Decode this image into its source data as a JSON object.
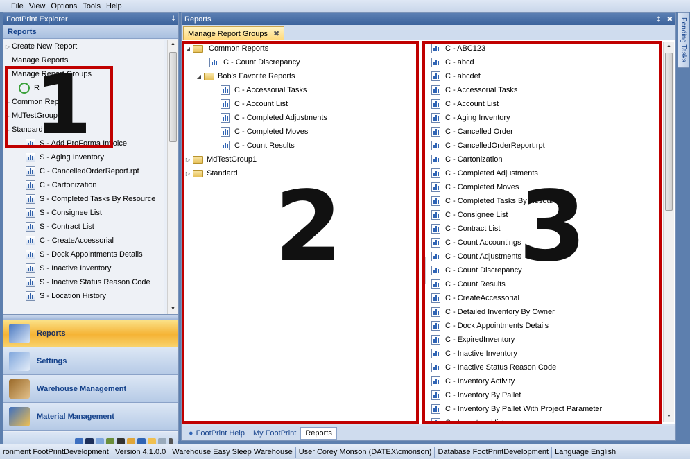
{
  "menu": [
    "File",
    "View",
    "Options",
    "Tools",
    "Help"
  ],
  "explorer": {
    "title": "FootPrint Explorer",
    "pin": "‡",
    "section": "Reports",
    "items": [
      {
        "label": "Create New Report",
        "type": "action"
      },
      {
        "label": "Manage Reports",
        "type": "action"
      },
      {
        "label": "Manage Report Groups",
        "type": "action"
      },
      {
        "label": "R",
        "type": "refresh"
      },
      {
        "label": "Common Reports",
        "type": "group"
      },
      {
        "label": "MdTestGroup1",
        "type": "group"
      },
      {
        "label": "Standard",
        "type": "group"
      },
      {
        "label": "S - Add ProForma Invoice",
        "type": "report"
      },
      {
        "label": "S - Aging Inventory",
        "type": "report"
      },
      {
        "label": "C - CancelledOrderReport.rpt",
        "type": "report"
      },
      {
        "label": "C - Cartonization",
        "type": "report"
      },
      {
        "label": "S - Completed Tasks By Resource",
        "type": "report"
      },
      {
        "label": "S - Consignee List",
        "type": "report"
      },
      {
        "label": "S - Contract List",
        "type": "report"
      },
      {
        "label": "C - CreateAccessorial",
        "type": "report"
      },
      {
        "label": "S - Dock Appointments Details",
        "type": "report"
      },
      {
        "label": "S - Inactive Inventory",
        "type": "report"
      },
      {
        "label": "S - Inactive Status Reason Code",
        "type": "report"
      },
      {
        "label": "S - Location History",
        "type": "report"
      }
    ],
    "nav": [
      "Reports",
      "Settings",
      "Warehouse Management",
      "Material Management"
    ]
  },
  "reports_pane": {
    "title": "Reports",
    "pin": "‡",
    "close": "✖",
    "tab_label": "Manage Report Groups",
    "tab_close": "✖",
    "groups_tree": [
      {
        "label": "Common Reports",
        "level": 0,
        "kind": "folder",
        "expanded": true
      },
      {
        "label": "C - Count Discrepancy",
        "level": 1,
        "kind": "report"
      },
      {
        "label": "Bob's Favorite Reports",
        "level": 1,
        "kind": "folder",
        "expanded": true
      },
      {
        "label": "C - Accessorial Tasks",
        "level": 2,
        "kind": "report"
      },
      {
        "label": "C - Account List",
        "level": 2,
        "kind": "report"
      },
      {
        "label": "C - Completed Adjustments",
        "level": 2,
        "kind": "report"
      },
      {
        "label": "C - Completed Moves",
        "level": 2,
        "kind": "report"
      },
      {
        "label": "C - Count Results",
        "level": 2,
        "kind": "report"
      },
      {
        "label": "MdTestGroup1",
        "level": 0,
        "kind": "folder",
        "expanded": false
      },
      {
        "label": "Standard",
        "level": 0,
        "kind": "folder",
        "expanded": false
      }
    ],
    "available_reports": [
      "C - ABC123",
      "C - abcd",
      "C - abcdef",
      "C - Accessorial Tasks",
      "C - Account List",
      "C - Aging Inventory",
      "C - Cancelled Order",
      "C - CancelledOrderReport.rpt",
      "C - Cartonization",
      "C - Completed Adjustments",
      "C - Completed Moves",
      "C - Completed Tasks By Resource",
      "C - Consignee List",
      "C - Contract List",
      "C - Count Accountings",
      "C - Count Adjustments",
      "C - Count Discrepancy",
      "C - Count Results",
      "C - CreateAccessorial",
      "C - Detailed Inventory By Owner",
      "C - Dock Appointments Details",
      "C - ExpiredInventory",
      "C - Inactive Inventory",
      "C - Inactive Status Reason Code",
      "C - Inventory Activity",
      "C - Inventory By Pallet",
      "C - Inventory By Pallet With Project Parameter",
      "C - Inventory History"
    ],
    "bottom_tabs": [
      "FootPrint Help",
      "My FootPrint",
      "Reports"
    ]
  },
  "annotations": {
    "one": "1",
    "two": "2",
    "three": "3"
  },
  "pending_tasks": "Pending Tasks",
  "status": [
    "ronment FootPrintDevelopment",
    "Version 4.1.0.0",
    "Warehouse  Easy Sleep Warehouse",
    "User  Corey Monson (DATEX\\cmonson)",
    "Database  FootPrintDevelopment",
    "Language  English"
  ],
  "colors": {
    "accent_red": "#c00000",
    "nav_active": "#f5b335",
    "title_blue": "#3c639c"
  }
}
